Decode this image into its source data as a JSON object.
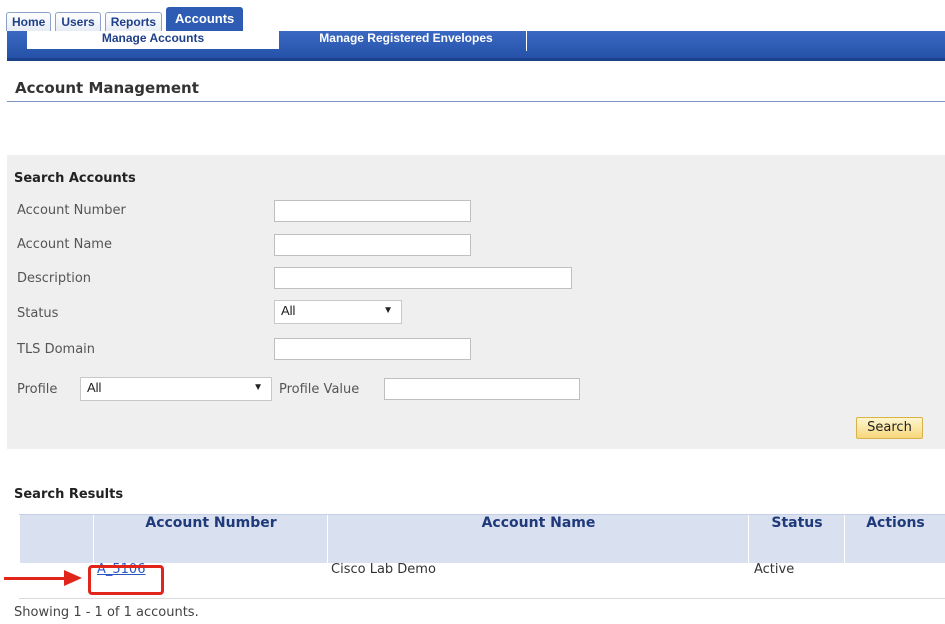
{
  "tabs": [
    "Home",
    "Users",
    "Reports",
    "Accounts"
  ],
  "subnav": {
    "manage_accounts": "Manage Accounts",
    "manage_envelopes": "Manage Registered Envelopes"
  },
  "page_title": "Account Management",
  "search": {
    "title": "Search Accounts",
    "account_number_label": "Account Number",
    "account_number_value": "",
    "account_name_label": "Account Name",
    "account_name_value": "",
    "description_label": "Description",
    "description_value": "",
    "status_label": "Status",
    "status_value": "All",
    "tls_domain_label": "TLS Domain",
    "tls_domain_value": "",
    "profile_label": "Profile",
    "profile_value_selected": "All",
    "profile_value_label": "Profile Value",
    "profile_value_input": "",
    "button": "Search"
  },
  "results": {
    "title": "Search Results",
    "headers": [
      "Account Number",
      "Account Name",
      "Status",
      "Actions"
    ],
    "rows": [
      {
        "account_number": "A_5106",
        "account_name": "Cisco Lab Demo",
        "status": "Active",
        "actions": ""
      }
    ],
    "summary": "Showing 1 - 1 of 1 accounts."
  },
  "colors": {
    "accent": "#2e5bb3",
    "highlight": "#e1251b",
    "button": "#f6d77c"
  }
}
